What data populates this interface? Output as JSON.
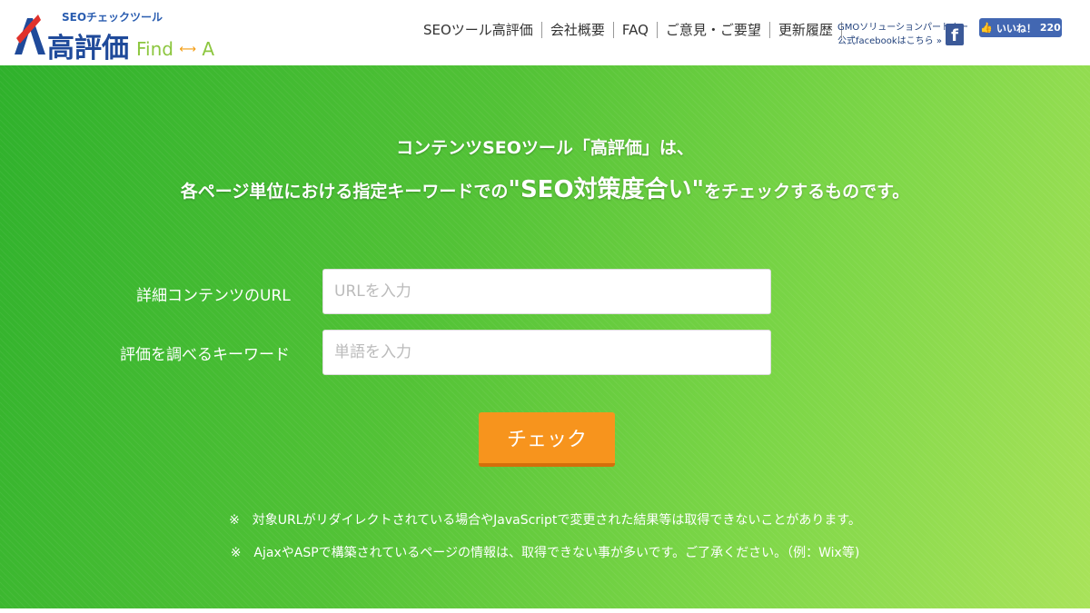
{
  "header": {
    "logo": {
      "sub": "SEOチェックツール",
      "main": "高評価",
      "find": "Find",
      "arrow": "⟷",
      "a": "A"
    },
    "nav": [
      {
        "label": "SEOツール高評価"
      },
      {
        "label": "会社概要"
      },
      {
        "label": "FAQ"
      },
      {
        "label": "ご意見・ご要望"
      },
      {
        "label": "更新履歴"
      }
    ],
    "gmo_line1": "GMOソリューションパートナー",
    "gmo_line2": "公式facebookはこちら »",
    "fb_icon": "f",
    "like_label": "いいね！",
    "like_count": "220"
  },
  "hero": {
    "headline1": "コンテンツSEOツール「高評価」は、",
    "headline2_pre": "各ページ単位における指定キーワードでの",
    "headline2_big": "\"SEO対策度合い\"",
    "headline2_post": "をチェックするものです。",
    "url_label": "詳細コンテンツのURL",
    "url_placeholder": "URLを入力",
    "kw_label": "評価を調べるキーワード",
    "kw_placeholder": "単語を入力",
    "check_label": "チェック",
    "note1": "※　対象URLがリダイレクトされている場合やJavaScriptで変更された結果等は取得できないことがあります。",
    "note2": "※　AjaxやASPで構築されているページの情報は、取得できない事が多いです。ご了承ください。（例：Wix等)"
  },
  "colors": {
    "brand_blue": "#1f4a9a",
    "hero_green": "#52c236",
    "button_orange": "#f7941d",
    "facebook_blue": "#4267b2"
  }
}
